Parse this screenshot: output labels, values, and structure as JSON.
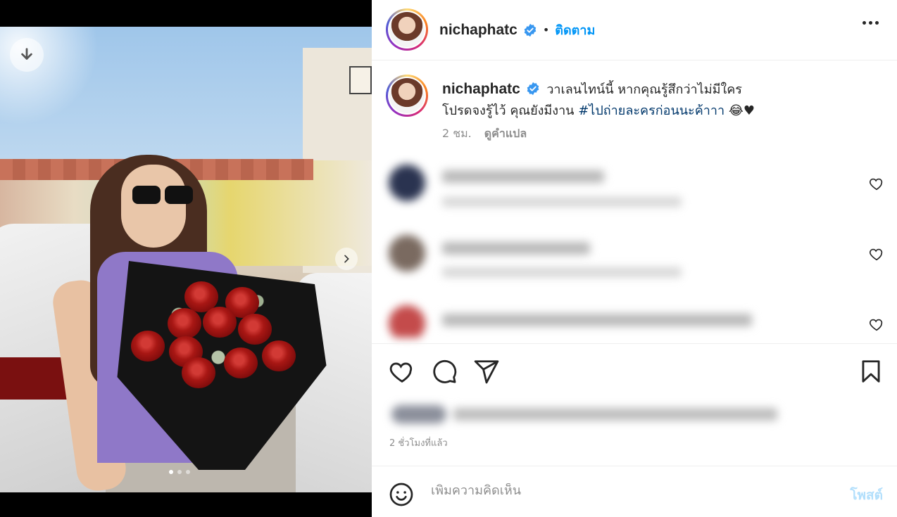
{
  "media": {
    "download_icon": "download-arrow-icon",
    "next_icon": "chevron-right-icon",
    "carousel": {
      "count": 3,
      "active": 1
    }
  },
  "header": {
    "username": "nichaphatc",
    "verified_icon": "verified-badge-icon",
    "separator": "•",
    "follow_label": "ติดตาม",
    "more_icon": "more-horizontal-icon"
  },
  "caption": {
    "username": "nichaphatc",
    "text_part1": "วาเลนไทน์นี้ หากคุณรู้สึกว่าไม่มีใคร",
    "text_part2": "โปรดจงรู้ไว้ คุณยังมีงาน",
    "hashtag": "#ไปถ่ายละครก่อนนะค้าาา",
    "emoji": "😂♥",
    "age": "2 ชม.",
    "translate_label": "ดูคำแปล"
  },
  "actions": {
    "like_icon": "heart-icon",
    "comment_icon": "comment-bubble-icon",
    "share_icon": "paper-plane-icon",
    "save_icon": "bookmark-icon"
  },
  "post_time": "2 ชั่วโมงที่แล้ว",
  "composer": {
    "placeholder": "เพิ่มความคิดเห็น",
    "post_label": "โพสต์",
    "emoji_icon": "smiley-face-icon"
  },
  "colors": {
    "link_blue": "#0095f6",
    "hashtag_blue": "#00376b",
    "muted": "#8e8e8e",
    "post_disabled": "#b2dffc"
  }
}
